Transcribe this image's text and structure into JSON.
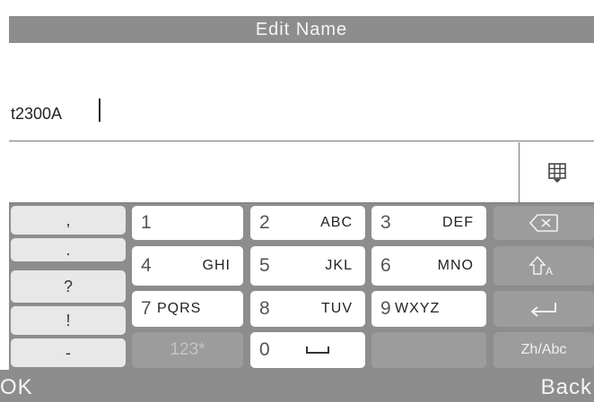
{
  "header": {
    "title": "Edit Name"
  },
  "input": {
    "value": "t2300A"
  },
  "keyboard": {
    "punctuation": [
      ",",
      ".",
      "?",
      "!",
      "-"
    ],
    "keys": [
      {
        "num": "1",
        "letters": ""
      },
      {
        "num": "2",
        "letters": "ABC"
      },
      {
        "num": "3",
        "letters": "DEF"
      },
      {
        "num": "4",
        "letters": "GHI"
      },
      {
        "num": "5",
        "letters": "JKL"
      },
      {
        "num": "6",
        "letters": "MNO"
      },
      {
        "num": "7",
        "letters": "PQRS"
      },
      {
        "num": "8",
        "letters": "TUV"
      },
      {
        "num": "9",
        "letters": "WXYZ"
      }
    ],
    "mode_123": "123*",
    "zero": "0",
    "lang_toggle": "Zh/Abc"
  },
  "footer": {
    "ok": "OK",
    "back": "Back"
  },
  "icons": {
    "backspace": "backspace-icon",
    "shift": "shift-icon",
    "enter": "enter-icon",
    "space": "space-icon",
    "candidates": "grid-icon"
  },
  "colors": {
    "bar": "#8d8d8d",
    "key": "#ffffff",
    "punct_key": "#e8e8e8",
    "func_key": "#9c9c9c"
  }
}
